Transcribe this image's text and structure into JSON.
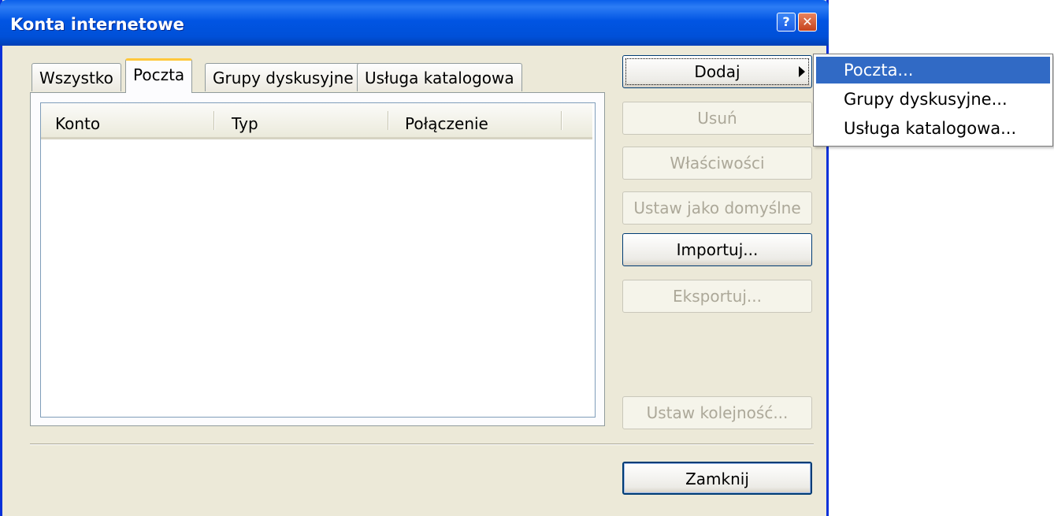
{
  "window": {
    "title": "Konta internetowe",
    "help_glyph": "?",
    "close_glyph": "✕"
  },
  "tabs": [
    {
      "label": "Wszystko",
      "active": false
    },
    {
      "label": "Poczta",
      "active": true
    },
    {
      "label": "Grupy dyskusyjne",
      "active": false
    },
    {
      "label": "Usługa katalogowa",
      "active": false
    }
  ],
  "list": {
    "columns": [
      "Konto",
      "Typ",
      "Połączenie"
    ],
    "rows": []
  },
  "buttons": {
    "add": "Dodaj",
    "remove": "Usuń",
    "properties": "Właściwości",
    "set_default": "Ustaw jako domyślne",
    "import": "Importuj...",
    "export": "Eksportuj...",
    "set_order": "Ustaw kolejność...",
    "close": "Zamknij"
  },
  "add_menu": {
    "items": [
      "Poczta...",
      "Grupy dyskusyjne...",
      "Usługa katalogowa..."
    ],
    "highlighted_index": 0
  },
  "colors": {
    "titlebar": "#0055e5",
    "dialog_bg": "#ece9d8",
    "menu_highlight": "#316ac5",
    "active_tab_accent": "#ffc83c"
  }
}
